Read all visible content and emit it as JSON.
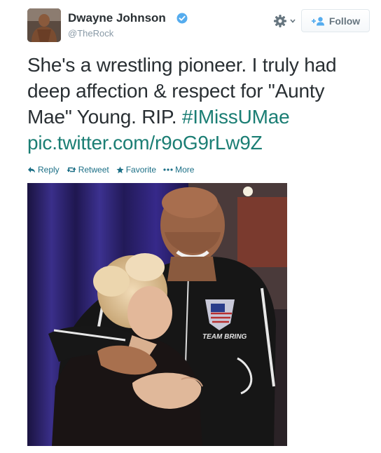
{
  "author": {
    "name": "Dwayne Johnson",
    "handle": "@TheRock",
    "verified": true,
    "avatar_icon": "avatar-photo"
  },
  "header": {
    "settings_icon": "gear-icon",
    "follow_label": "Follow"
  },
  "tweet": {
    "text_line1": "She's a wrestling pioneer. I truly had",
    "text_line2": "deep affection & respect for \"Aunty",
    "text_line3a": "Mae\" Young. RIP. ",
    "hashtag": "#IMissUMae",
    "pic_link": "pic.twitter.com/r9oG9rLw9Z"
  },
  "actions": {
    "reply_label": "Reply",
    "retweet_label": "Retweet",
    "favorite_label": "Favorite",
    "more_label": "More"
  },
  "photo": {
    "shirt_text": "TEAM BRING"
  },
  "colors": {
    "link": "#1b7e74",
    "action": "#1b6f86",
    "verified": "#55acee",
    "muted": "#8899a6"
  }
}
